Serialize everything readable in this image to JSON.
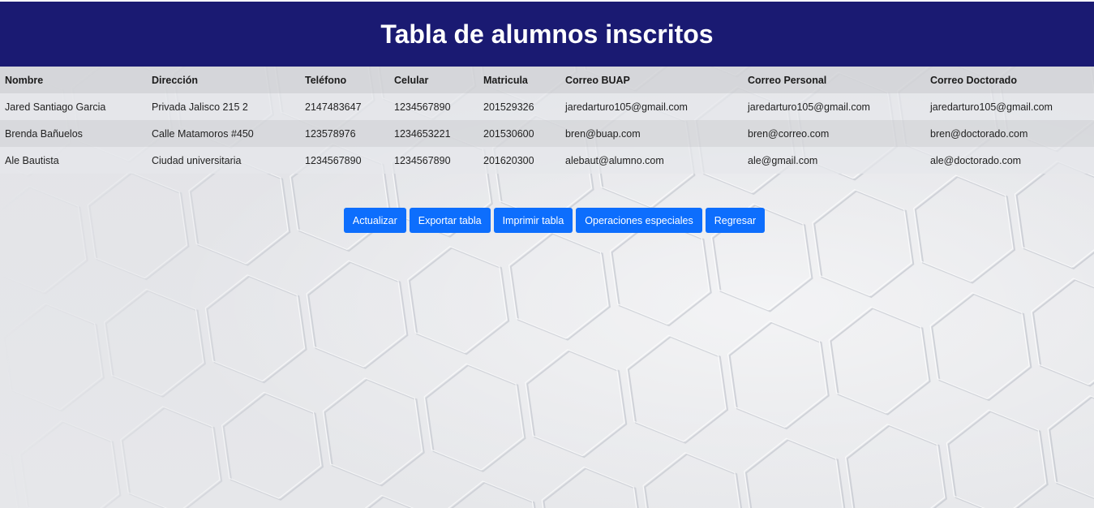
{
  "header": {
    "title": "Tabla de alumnos inscritos"
  },
  "table": {
    "columns": [
      "Nombre",
      "Dirección",
      "Teléfono",
      "Celular",
      "Matricula",
      "Correo BUAP",
      "Correo Personal",
      "Correo Doctorado"
    ],
    "rows": [
      [
        "Jared Santiago Garcia",
        "Privada Jalisco 215 2",
        "2147483647",
        "1234567890",
        "201529326",
        "jaredarturo105@gmail.com",
        "jaredarturo105@gmail.com",
        "jaredarturo105@gmail.com"
      ],
      [
        "Brenda Bañuelos",
        "Calle Matamoros #450",
        "123578976",
        "1234653221",
        "201530600",
        "bren@buap.com",
        "bren@correo.com",
        "bren@doctorado.com"
      ],
      [
        "Ale Bautista",
        "Ciudad universitaria",
        "1234567890",
        "1234567890",
        "201620300",
        "alebaut@alumno.com",
        "ale@gmail.com",
        "ale@doctorado.com"
      ]
    ]
  },
  "actions": {
    "update": "Actualizar",
    "export": "Exportar tabla",
    "print": "Imprimir tabla",
    "special": "Operaciones especiales",
    "back": "Regresar"
  },
  "colors": {
    "header_bg": "#1a1a72",
    "button_bg": "#0d6efd"
  }
}
